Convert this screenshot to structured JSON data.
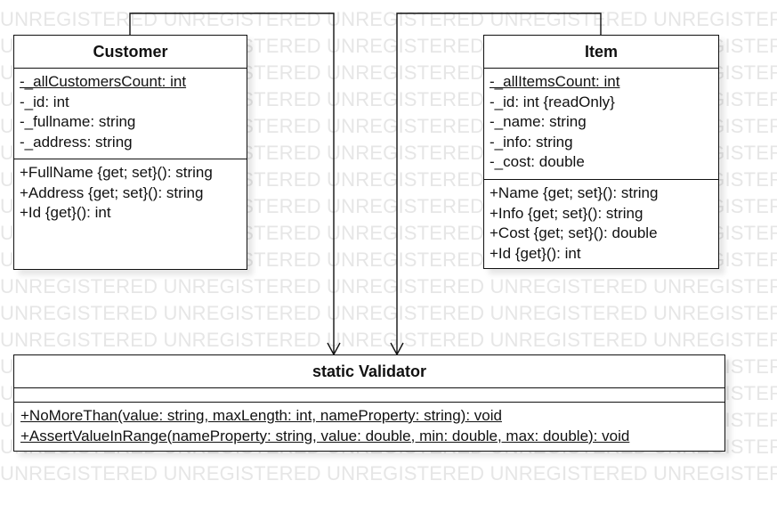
{
  "watermark": {
    "rows": [
      "UNREGISTERED UNREGISTERED UNREGISTERED UNREGISTERED UNREGISTERED",
      "UNREGISTERED UNREGISTERED UNREGISTERED UNREGISTERED UNREGISTERED",
      "UNREGISTERED UNREGISTERED UNREGISTERED UNREGISTERED UNREGISTERED",
      "UNREGISTERED UNREGISTERED UNREGISTERED UNREGISTERED UNREGISTERED",
      "UNREGISTERED UNREGISTERED UNREGISTERED UNREGISTERED UNREGISTERED",
      "UNREGISTERED UNREGISTERED UNREGISTERED UNREGISTERED UNREGISTERED",
      "UNREGISTERED UNREGISTERED UNREGISTERED UNREGISTERED UNREGISTERED",
      "UNREGISTERED UNREGISTERED UNREGISTERED UNREGISTERED UNREGISTERED",
      "UNREGISTERED UNREGISTERED UNREGISTERED UNREGISTERED UNREGISTERED",
      "UNREGISTERED UNREGISTERED UNREGISTERED UNREGISTERED UNREGISTERED",
      "UNREGISTERED UNREGISTERED UNREGISTERED UNREGISTERED UNREGISTERED",
      "UNREGISTERED UNREGISTERED UNREGISTERED UNREGISTERED UNREGISTERED",
      "UNREGISTERED UNREGISTERED UNREGISTERED UNREGISTERED UNREGISTERED",
      "UNREGISTERED UNREGISTERED UNREGISTERED UNREGISTERED UNREGISTERED",
      "UNREGISTERED UNREGISTERED UNREGISTERED UNREGISTERED UNREGISTERED",
      "UNREGISTERED UNREGISTERED UNREGISTERED UNREGISTERED UNREGISTERED",
      "UNREGISTERED UNREGISTERED UNREGISTERED UNREGISTERED UNREGISTERED",
      "UNREGISTERED UNREGISTERED UNREGISTERED UNREGISTERED UNREGISTERED"
    ]
  },
  "customer": {
    "name": "Customer",
    "attributes": [
      {
        "text": "-_allCustomersCount: int",
        "static": true
      },
      {
        "text": "-_id: int",
        "static": false
      },
      {
        "text": "-_fullname: string",
        "static": false
      },
      {
        "text": "-_address: string",
        "static": false
      }
    ],
    "operations": [
      {
        "text": "+FullName {get; set}(): string",
        "static": false
      },
      {
        "text": "+Address {get; set}(): string",
        "static": false
      },
      {
        "text": "+Id {get}(): int",
        "static": false
      }
    ]
  },
  "item": {
    "name": "Item",
    "attributes": [
      {
        "text": "-_allItemsCount: int",
        "static": true
      },
      {
        "text": "-_id: int {readOnly}",
        "static": false
      },
      {
        "text": "-_name: string",
        "static": false
      },
      {
        "text": "-_info: string",
        "static": false
      },
      {
        "text": "-_cost: double",
        "static": false
      }
    ],
    "operations": [
      {
        "text": "+Name {get; set}(): string",
        "static": false
      },
      {
        "text": "+Info {get; set}(): string",
        "static": false
      },
      {
        "text": "+Cost {get; set}(): double",
        "static": false
      },
      {
        "text": "+Id {get}(): int",
        "static": false
      }
    ]
  },
  "validator": {
    "name": "static Validator",
    "attributes": [],
    "operations": [
      {
        "text": "+NoMoreThan(value: string, maxLength: int, nameProperty: string): void",
        "static": true
      },
      {
        "text": "+AssertValueInRange(nameProperty: string, value: double, min: double, max: double): void",
        "static": true
      }
    ]
  },
  "relations": [
    {
      "from": "Customer",
      "to": "static Validator",
      "type": "dependency"
    },
    {
      "from": "Item",
      "to": "static Validator",
      "type": "dependency"
    }
  ]
}
